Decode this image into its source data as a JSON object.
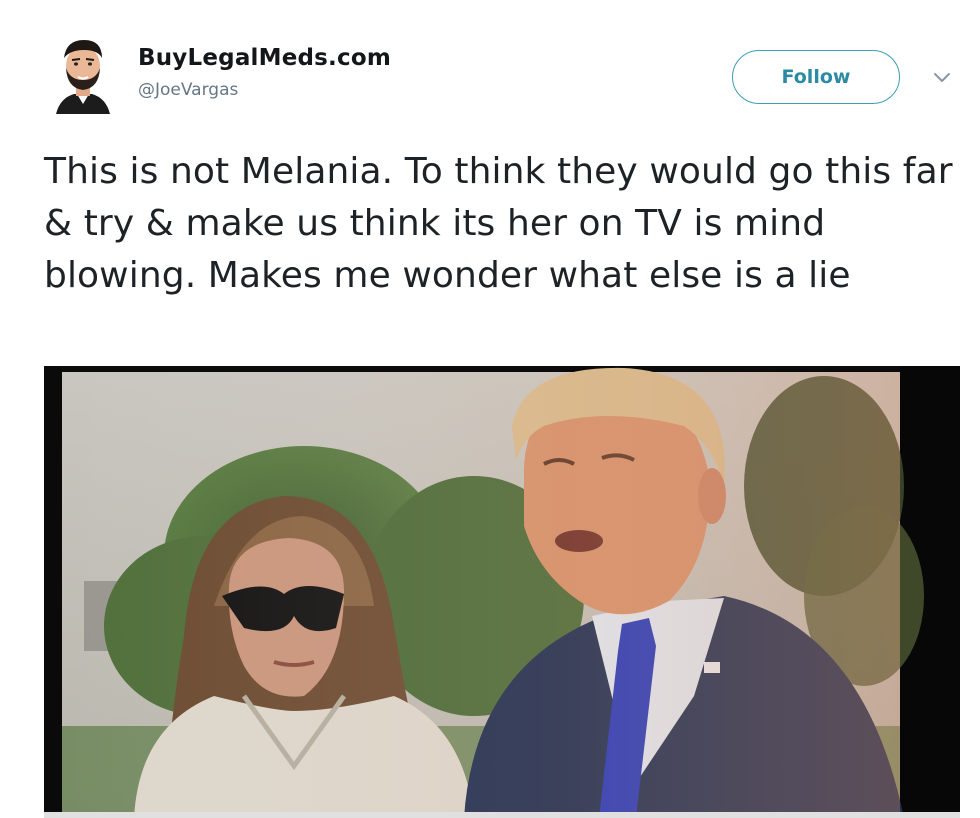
{
  "tweet": {
    "author": {
      "display_name": "BuyLegalMeds.com",
      "handle": "@JoeVargas",
      "avatar_icon": "cartoon-avatar-icon"
    },
    "follow_label": "Follow",
    "menu_icon": "chevron-down-icon",
    "text": "This is not Melania. To think they would go this far & try & make us think its her on TV is mind blowing. Makes me wonder what else is a lie",
    "media": {
      "type": "video-still-photo",
      "icon": "tv-screen-photo"
    }
  },
  "colors": {
    "text": "#14171a",
    "handle": "#657786",
    "follow_accent": "#2d8aa3",
    "media_background": "#0b0b0c"
  }
}
